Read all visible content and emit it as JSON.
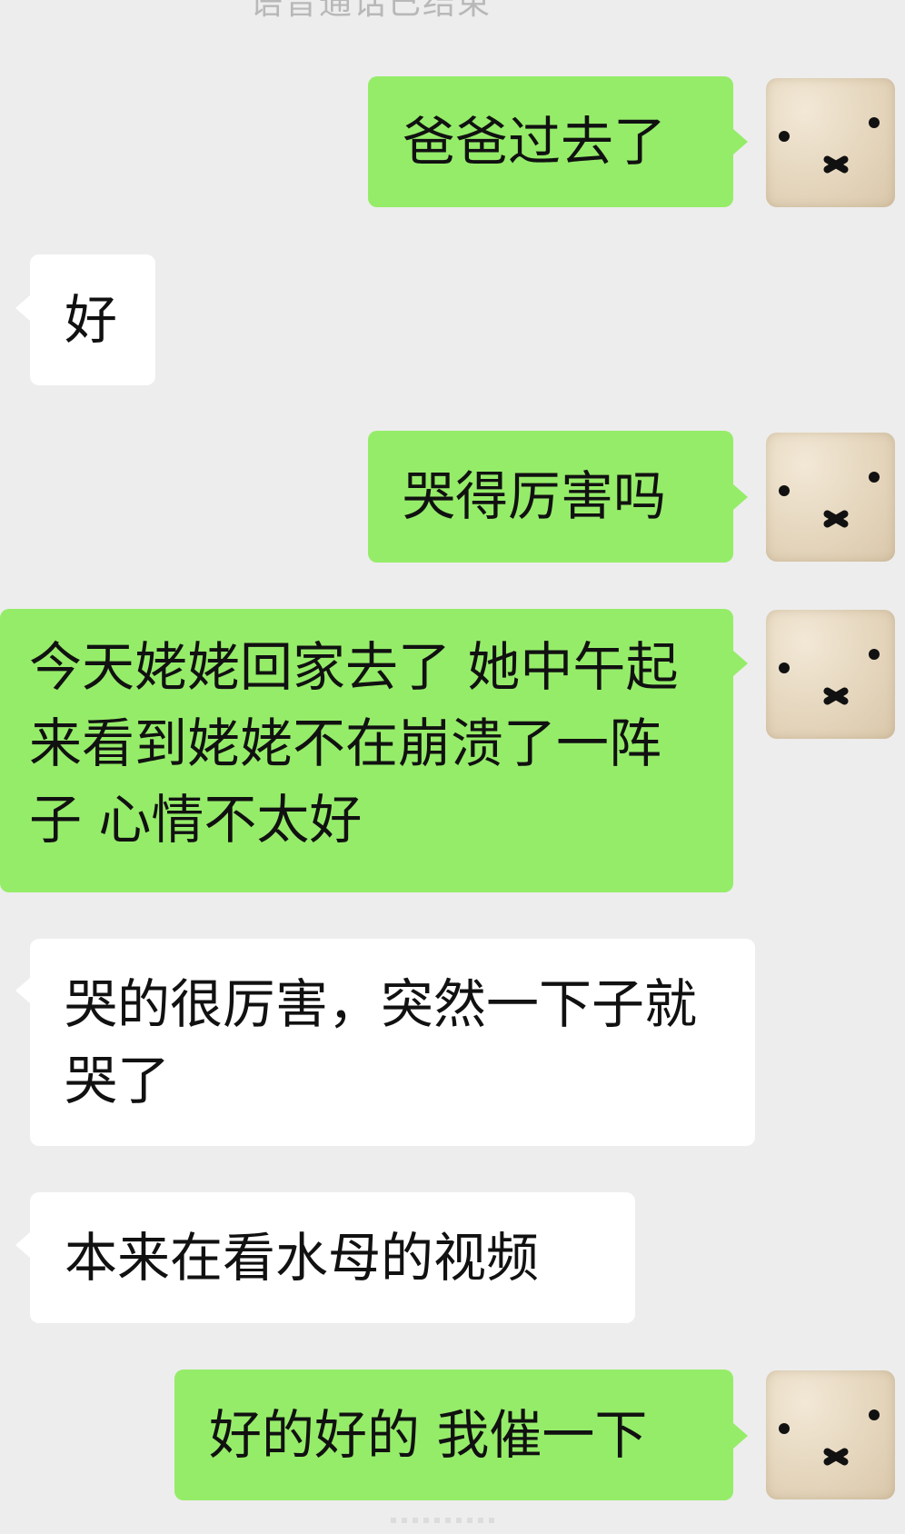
{
  "system_notice": "语音通话已结束",
  "messages": [
    {
      "side": "out",
      "text": "爸爸过去了"
    },
    {
      "side": "in",
      "text": "好"
    },
    {
      "side": "out",
      "text": "哭得厉害吗"
    },
    {
      "side": "out",
      "text": "今天姥姥回家去了 她中午起来看到姥姥不在崩溃了一阵子 心情不太好"
    },
    {
      "side": "in",
      "text": "哭的很厉害，突然一下子就哭了"
    },
    {
      "side": "in",
      "text": "本来在看水母的视频"
    },
    {
      "side": "out",
      "text": "好的好的 我催一下"
    }
  ],
  "colors": {
    "background": "#ededed",
    "outgoing_bubble": "#95ec69",
    "incoming_bubble": "#ffffff",
    "text": "#111111",
    "notice": "#b8b8b8"
  },
  "icons": {
    "avatar": "bunny-face-avatar-icon"
  }
}
